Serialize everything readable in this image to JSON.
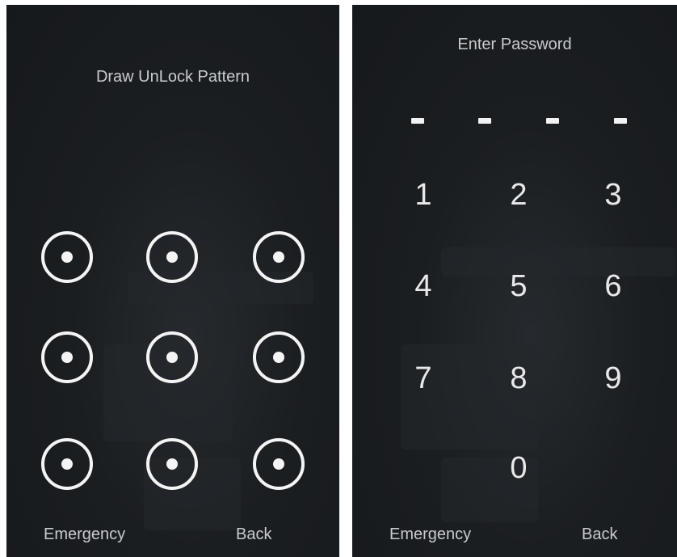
{
  "pattern_screen": {
    "title": "Draw UnLock Pattern",
    "dot_count": 9,
    "emergency_label": "Emergency",
    "back_label": "Back"
  },
  "pin_screen": {
    "title": "Enter Password",
    "entered_digits": 0,
    "max_digits": 4,
    "keys": [
      "1",
      "2",
      "3",
      "4",
      "5",
      "6",
      "7",
      "8",
      "9",
      "0"
    ],
    "emergency_label": "Emergency",
    "back_label": "Back"
  },
  "colors": {
    "background": "#1b1e21",
    "text": "#c9cbcd",
    "accent": "#f4f4f4"
  }
}
